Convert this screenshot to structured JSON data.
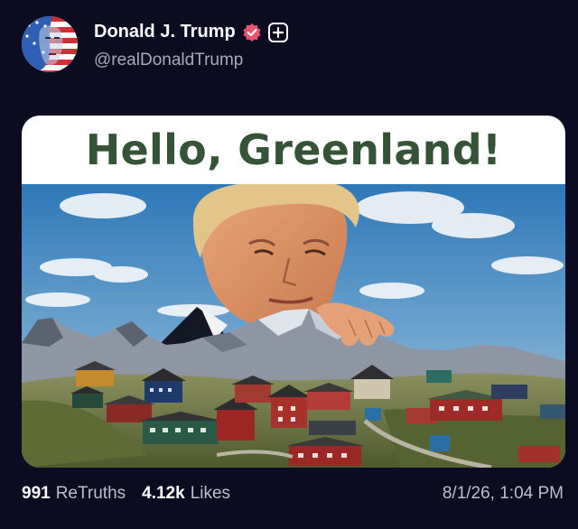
{
  "author": {
    "display_name": "Donald J. Trump",
    "handle": "@realDonaldTrump"
  },
  "post": {
    "image_title": "Hello, Greenland!",
    "retruths_count": "991",
    "retruths_label": "ReTruths",
    "likes_count": "4.12k",
    "likes_label": "Likes",
    "timestamp": "8/1/26, 1:04 PM"
  },
  "colors": {
    "background": "#0b0b22",
    "verified_badge": "#e8546e",
    "title_text": "#355336"
  },
  "icons": {
    "verified": "verified-badge-icon",
    "follow": "plus-icon"
  }
}
